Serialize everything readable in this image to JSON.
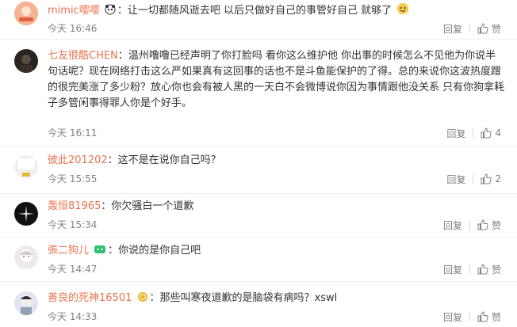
{
  "comments": [
    {
      "user": "mimic嘤嘤",
      "sep": "：",
      "text": "让一切都随风逝去吧  以后只做好自己的事管好自己  就够了",
      "time": "今天 16:46",
      "reply": "回复",
      "like_label": "赞",
      "like_count": ""
    },
    {
      "user": "七友很酷CHEN",
      "sep": "：",
      "text": "温州噜噜已经声明了你打脸吗  看你这么维护他  你出事的时候怎么不见他为你说半句话呢？现在网络打击这么严如果真有这回事的话也不是斗鱼能保护的了得。总的来说你这波热度蹭的很完美涨了多少粉？放心你也会有被人黑的一天白不会微博说你因为事情跟他没关系 只有你狗拿耗子多管闲事得罪人你是个好手。",
      "time": "今天 16:11",
      "reply": "回复",
      "like_label": "",
      "like_count": "4"
    },
    {
      "user": "彼此201202",
      "sep": "：",
      "text": "这不是在说你自己吗？",
      "time": "今天 15:55",
      "reply": "回复",
      "like_label": "",
      "like_count": "2"
    },
    {
      "user": "轰恒81965",
      "sep": "：",
      "text": "你欠骚白一个道歉",
      "time": "今天 15:34",
      "reply": "回复",
      "like_label": "赞",
      "like_count": ""
    },
    {
      "user": "張二狗儿",
      "sep": "：",
      "text": "你说的是你自己吧",
      "time": "今天 14:47",
      "reply": "回复",
      "like_label": "赞",
      "like_count": ""
    },
    {
      "user": "善良的死神16501",
      "sep": "：",
      "text": "那些叫寒夜道歉的是脑袋有病吗？xswl",
      "time": "今天 14:33",
      "reply": "回复",
      "like_label": "赞",
      "like_count": ""
    }
  ],
  "colors": {
    "username": "#eb7350",
    "meta": "#808080",
    "divider": "#eeeeee"
  }
}
